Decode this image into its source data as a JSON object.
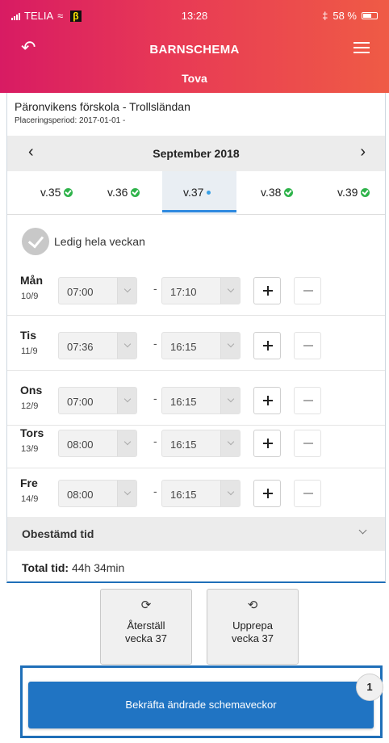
{
  "status": {
    "carrier": "TELIA",
    "beta": "β",
    "time": "13:28",
    "battery": "58 %"
  },
  "header": {
    "title": "BARNSCHEMA",
    "child": "Tova"
  },
  "placement": {
    "school": "Päronvikens förskola - Trollsländan",
    "period": "Placeringsperiod: 2017-01-01 -"
  },
  "month": {
    "label": "September 2018"
  },
  "weeks": [
    {
      "label": "v.35",
      "state": "done"
    },
    {
      "label": "v.36",
      "state": "done"
    },
    {
      "label": "v.37",
      "state": "active"
    },
    {
      "label": "v.38",
      "state": "done"
    },
    {
      "label": "v.39",
      "state": "done"
    }
  ],
  "ledig": {
    "label": "Ledig hela veckan"
  },
  "days": [
    {
      "name": "Mån",
      "date": "10/9",
      "start": "07:00",
      "end": "17:10"
    },
    {
      "name": "Tis",
      "date": "11/9",
      "start": "07:36",
      "end": "16:15"
    },
    {
      "name": "Ons",
      "date": "12/9",
      "start": "07:00",
      "end": "16:15"
    },
    {
      "name": "Tors",
      "date": "13/9",
      "start": "08:00",
      "end": "16:15"
    },
    {
      "name": "Fre",
      "date": "14/9",
      "start": "08:00",
      "end": "16:15"
    }
  ],
  "dash": "-",
  "undetermined": {
    "label": "Obestämd tid"
  },
  "total": {
    "label": "Total tid:",
    "value": "44h 34min"
  },
  "actions": {
    "reset": {
      "line1": "Återställ",
      "line2": "vecka 37"
    },
    "repeat": {
      "line1": "Upprepa",
      "line2": "vecka 37"
    }
  },
  "confirm": {
    "label": "Bekräfta ändrade schemaveckor",
    "badge": "1"
  },
  "colors": {
    "header_start": "#d81b63",
    "header_end": "#ef5b45",
    "primary": "#2074c3",
    "check": "#2eb34a"
  }
}
